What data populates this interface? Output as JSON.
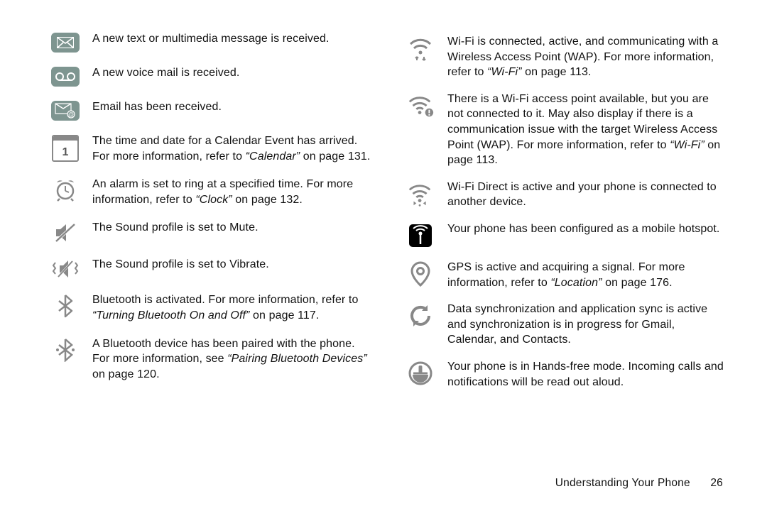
{
  "footer": {
    "section": "Understanding Your Phone",
    "page": "26"
  },
  "left": [
    {
      "icon": "message-icon",
      "html": "A new text or multimedia message is received."
    },
    {
      "icon": "voicemail-icon",
      "html": "A new voice mail is received."
    },
    {
      "icon": "email-icon",
      "html": "Email has been received."
    },
    {
      "icon": "calendar-icon",
      "html": "The time and date for a Calendar Event has arrived. For more information, refer to <em>“Calendar”</em> on page 131."
    },
    {
      "icon": "alarm-icon",
      "html": "An alarm is set to ring at a specified time. For more information, refer to <em>“Clock”</em> on page 132."
    },
    {
      "icon": "mute-icon",
      "html": "The Sound profile is set to Mute."
    },
    {
      "icon": "vibrate-icon",
      "html": "The Sound profile is set to Vibrate."
    },
    {
      "icon": "bluetooth-icon",
      "html": "Bluetooth is activated. For more information, refer to <em>“Turning Bluetooth On and Off”</em> on page 117."
    },
    {
      "icon": "bluetooth-paired-icon",
      "html": "A Bluetooth device has been paired with the phone. For more information, see <em>“Pairing Bluetooth Devices”</em> on page 120."
    }
  ],
  "right": [
    {
      "icon": "wifi-connected-icon",
      "html": "Wi-Fi is connected, active, and communicating with a Wireless Access Point (WAP). For more information, refer to <em>“Wi-Fi”</em> on page 113."
    },
    {
      "icon": "wifi-available-icon",
      "html": "There is a Wi-Fi access point available, but you are not connected to it. May also display if there is a communication issue with the target Wireless Access Point (WAP). For more information, refer to <em>“Wi-Fi”</em> on page 113."
    },
    {
      "icon": "wifi-direct-icon",
      "html": "Wi-Fi Direct is active and your phone is connected to another device."
    },
    {
      "icon": "hotspot-icon",
      "html": "Your phone has been configured as a mobile hotspot."
    },
    {
      "icon": "gps-icon",
      "html": "GPS is active and acquiring a signal. For more information, refer to <em>“Location”</em> on page 176."
    },
    {
      "icon": "sync-icon",
      "html": "Data synchronization and application sync is active and synchronization is in progress for Gmail, Calendar, and Contacts."
    },
    {
      "icon": "handsfree-icon",
      "html": "Your phone is in Hands-free mode. Incoming calls and notifications will be read out aloud."
    }
  ]
}
